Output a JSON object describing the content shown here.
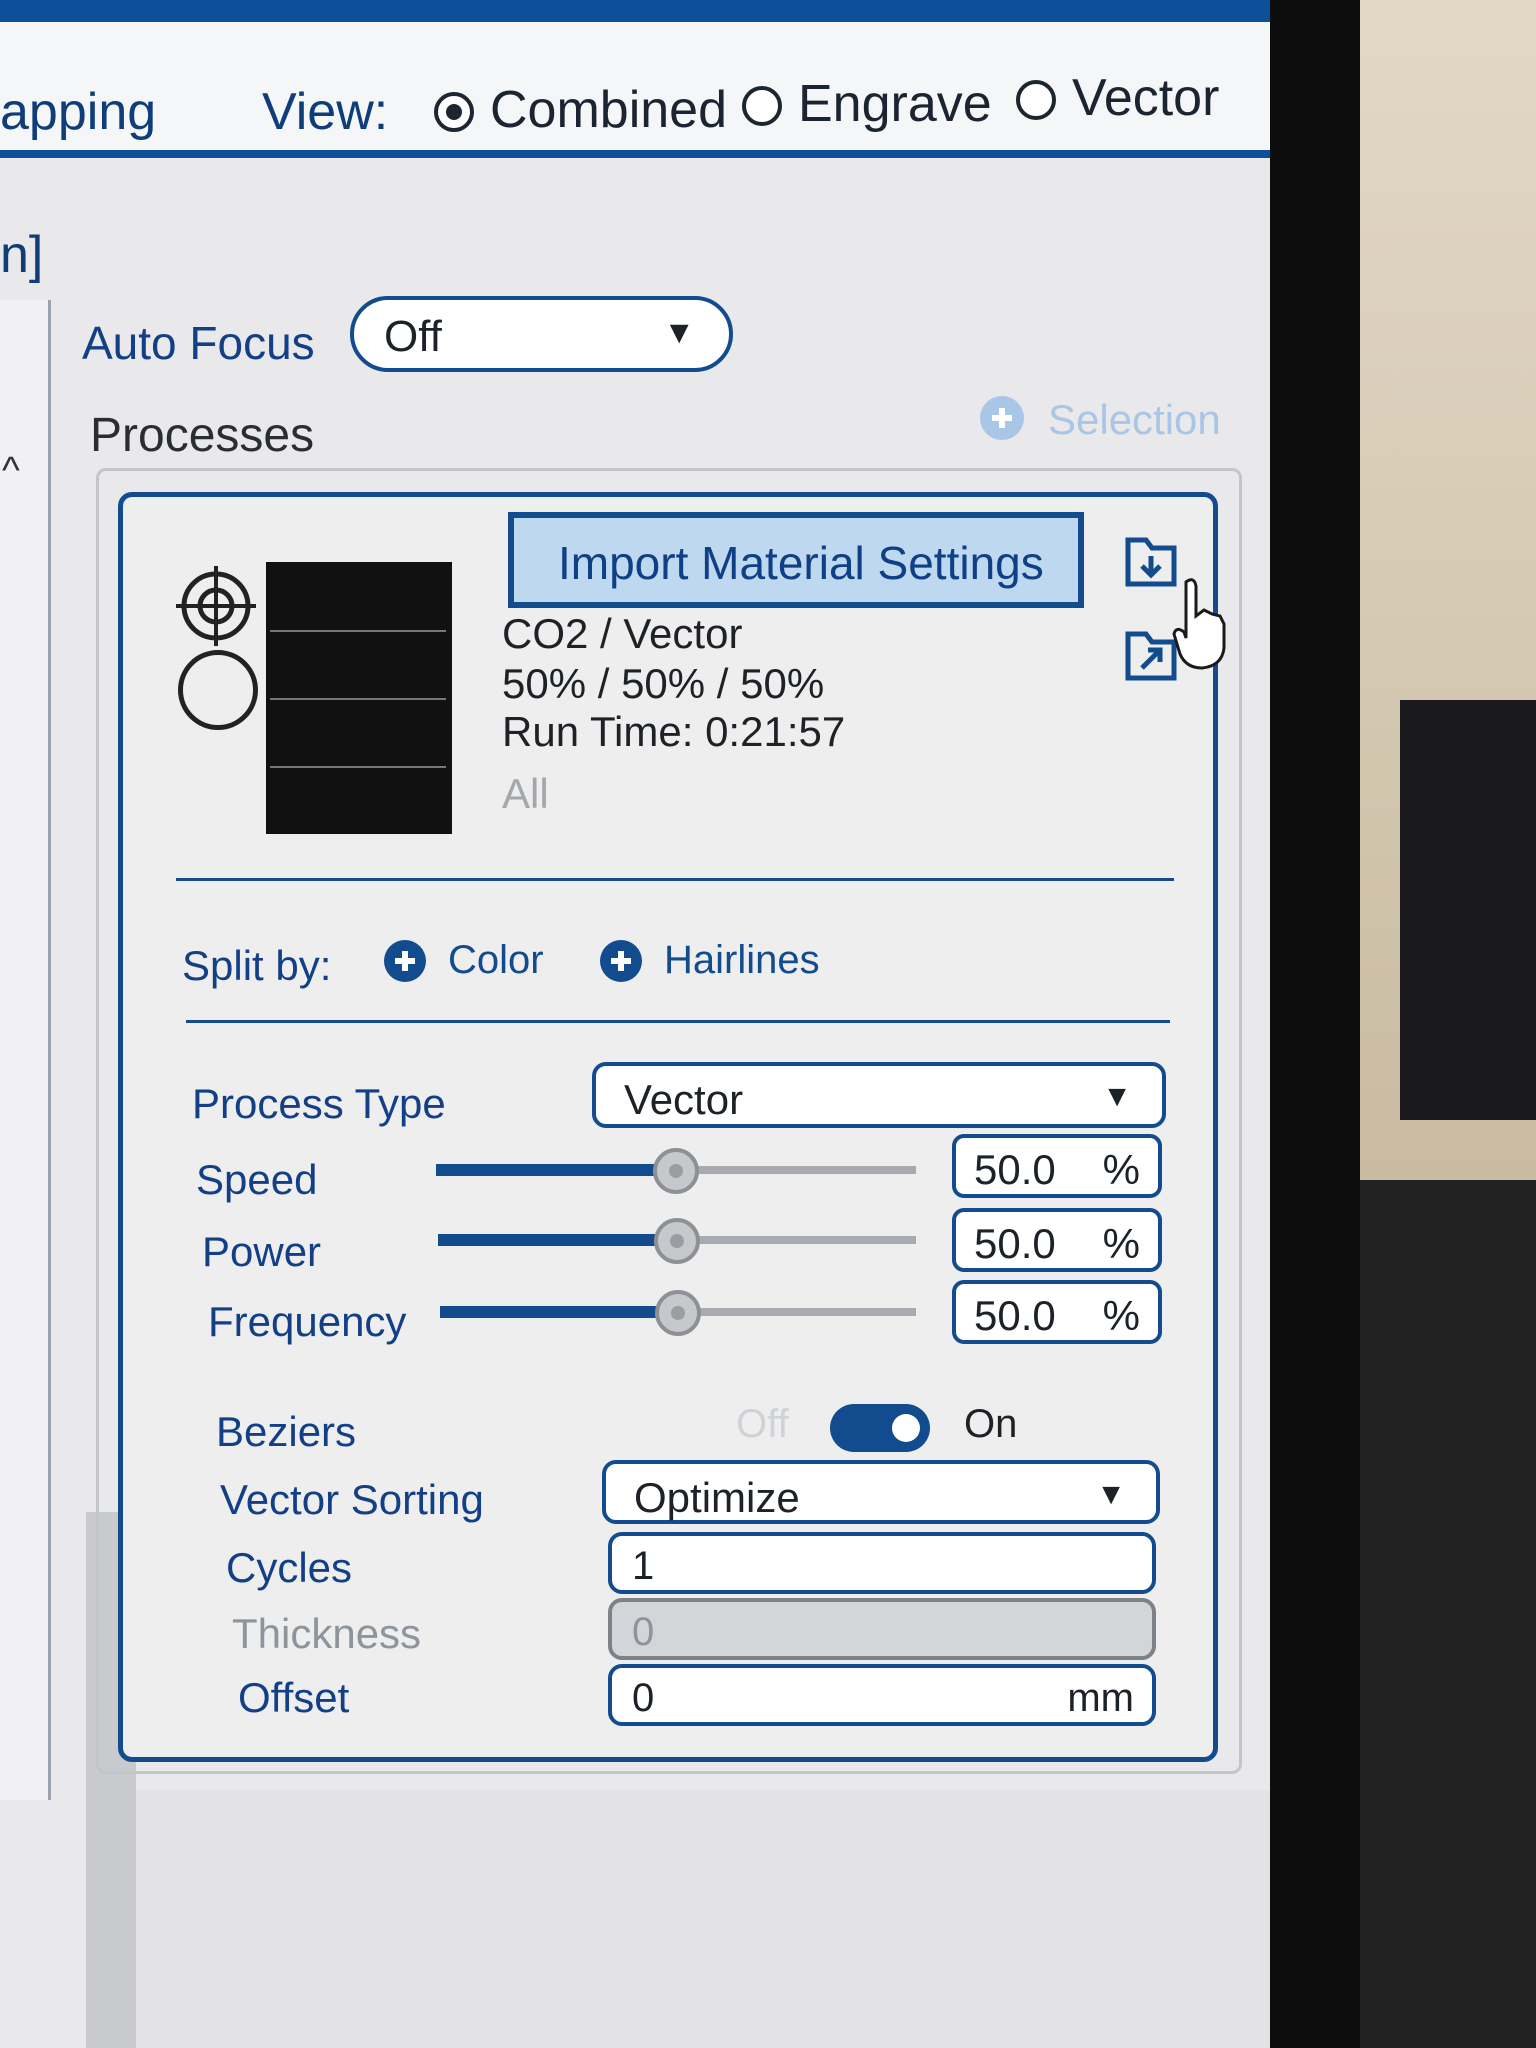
{
  "toolbar": {
    "mapping_label": "apping",
    "view_label": "View:",
    "view_options": [
      {
        "label": "Combined",
        "selected": true
      },
      {
        "label": "Engrave",
        "selected": false
      },
      {
        "label": "Vector",
        "selected": false
      }
    ]
  },
  "left_rail": {
    "bracket": "n]",
    "chevron": "^"
  },
  "auto_focus": {
    "label": "Auto Focus",
    "value": "Off",
    "arrow": "▼"
  },
  "processes": {
    "title": "Processes",
    "selection_label": "Selection",
    "import_button": "Import Material Settings",
    "info": {
      "laser": "CO2 / Vector",
      "settings": "50% / 50% / 50%",
      "run_time": "Run Time: 0:21:57",
      "scope": "All"
    },
    "split_by": {
      "label": "Split by:",
      "options": [
        "Color",
        "Hairlines"
      ]
    },
    "process_type": {
      "label": "Process Type",
      "value": "Vector",
      "arrow": "▼"
    },
    "sliders": [
      {
        "label": "Speed",
        "value": "50.0",
        "unit": "%",
        "fraction": 0.5
      },
      {
        "label": "Power",
        "value": "50.0",
        "unit": "%",
        "fraction": 0.5
      },
      {
        "label": "Frequency",
        "value": "50.0",
        "unit": "%",
        "fraction": 0.5
      }
    ],
    "beziers": {
      "label": "Beziers",
      "off_label": "Off",
      "on_label": "On",
      "on": true
    },
    "vector_sorting": {
      "label": "Vector Sorting",
      "value": "Optimize",
      "arrow": "▼"
    },
    "cycles": {
      "label": "Cycles",
      "value": "1"
    },
    "thickness": {
      "label": "Thickness",
      "value": "0"
    },
    "offset": {
      "label": "Offset",
      "value": "0",
      "unit": "mm"
    }
  },
  "colors": {
    "accent": "#124b8e",
    "selection_disabled": "#a9c6e6",
    "import_bg": "#bdd8ef"
  }
}
